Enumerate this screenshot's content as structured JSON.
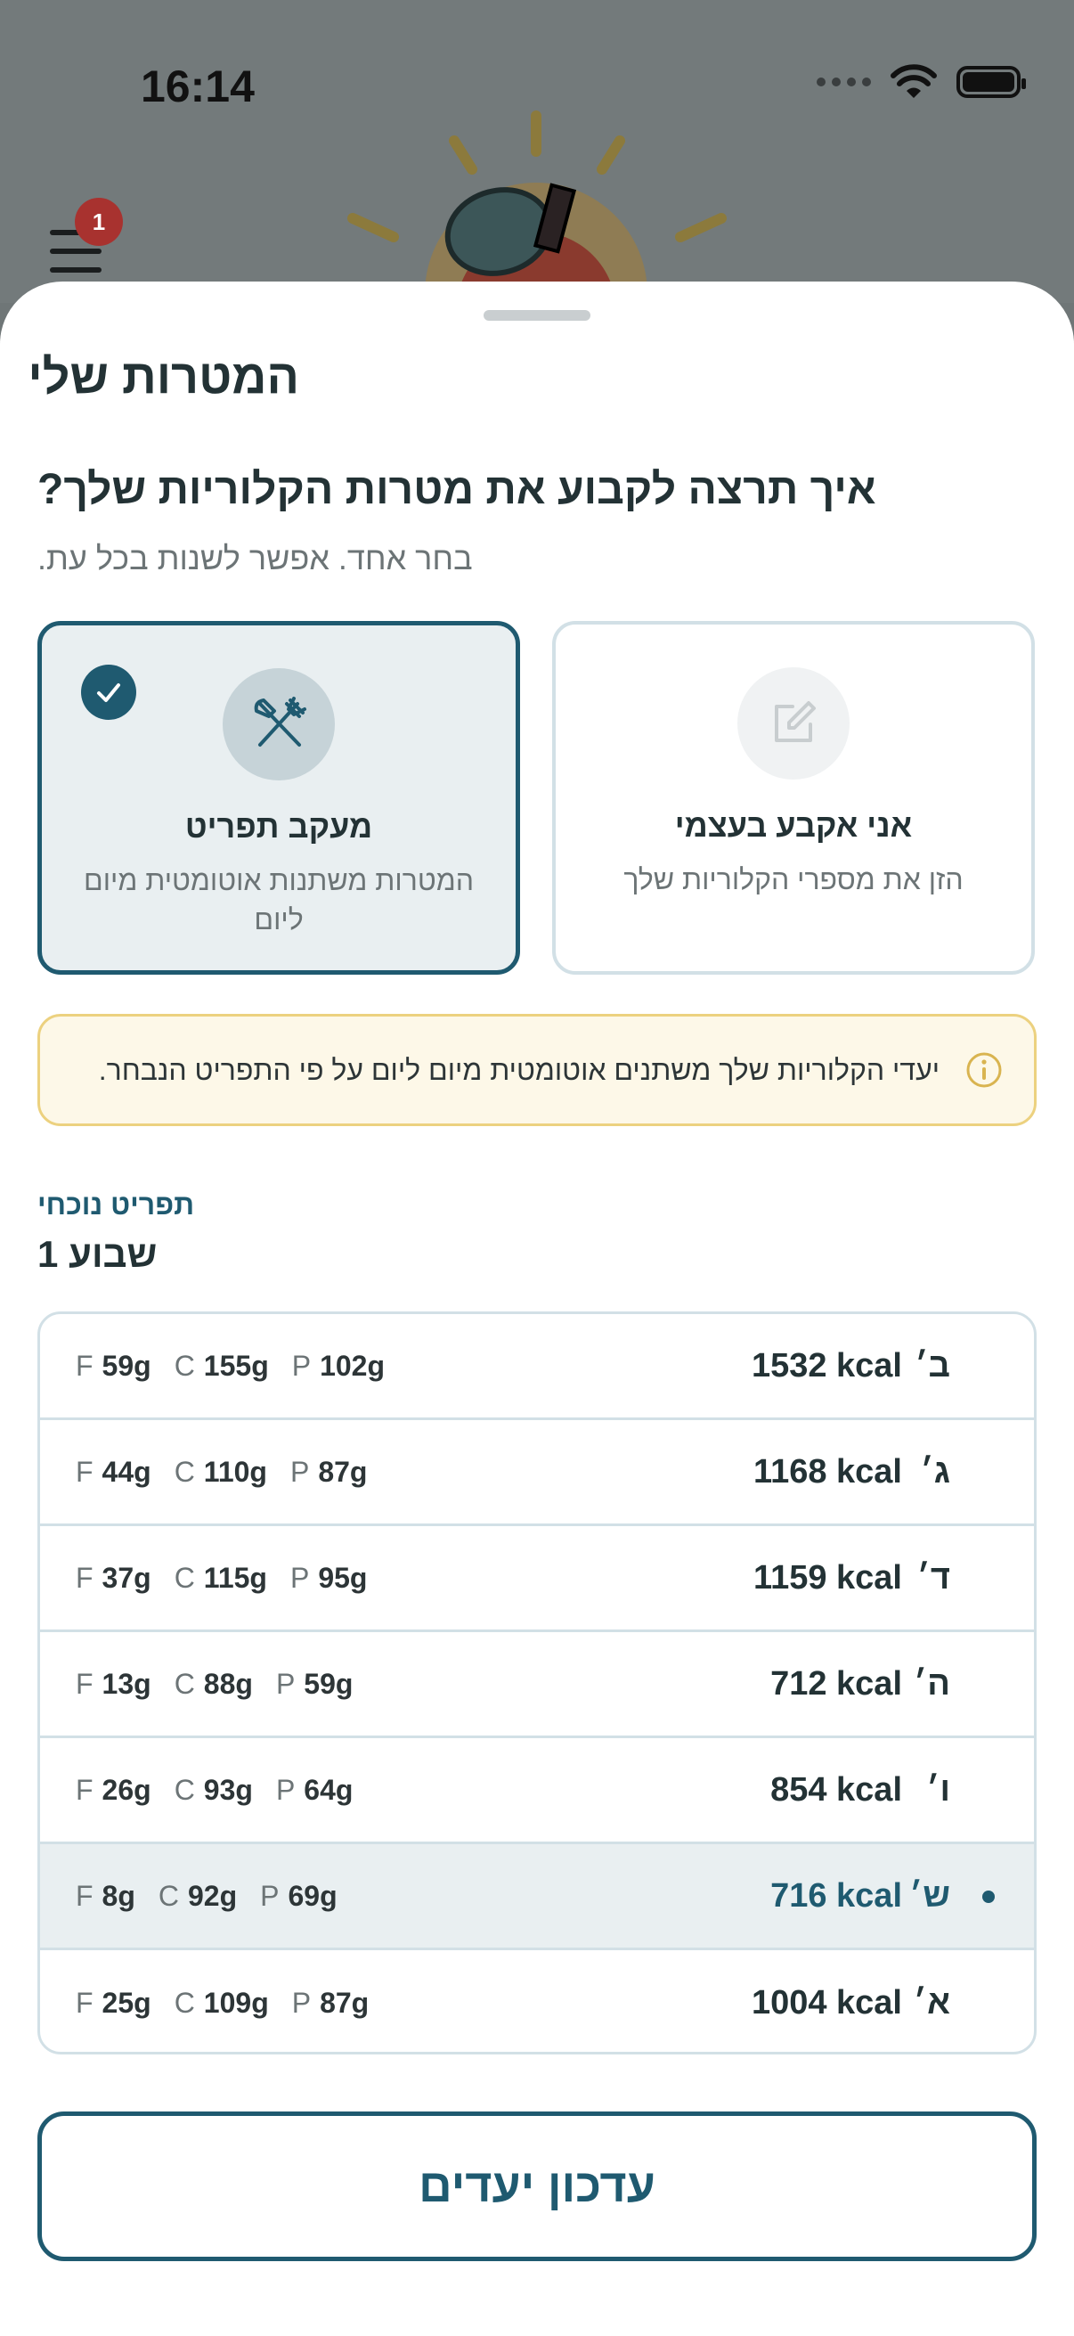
{
  "status_bar": {
    "time": "16:14"
  },
  "menu": {
    "badge_count": "1"
  },
  "sheet": {
    "title": "המטרות שלי",
    "question": "איך תרצה לקבוע את מטרות הקלוריות שלך?",
    "hint": "בחר אחד. אפשר לשנות בכל עת."
  },
  "options": {
    "tracker": {
      "title": "מעקב תפריט",
      "subtitle": "המטרות משתנות אוטומטית מיום ליום",
      "selected": true,
      "icon": "cutlery-icon"
    },
    "manual": {
      "title": "אני אקבע בעצמי",
      "subtitle": "הזן את מספרי הקלוריות שלך",
      "selected": false,
      "icon": "edit-icon"
    }
  },
  "info_banner": {
    "text": "יעדי הקלוריות שלך משתנים אוטומטית מיום ליום על פי התפריט הנבחר.",
    "icon": "info-icon"
  },
  "plan": {
    "label": "תפריט נוכחי",
    "name": "שבוע 1"
  },
  "days": [
    {
      "day": "ב׳",
      "kcal": "1532 kcal",
      "p": "102g",
      "c": "155g",
      "f": "59g"
    },
    {
      "day": "ג׳",
      "kcal": "1168 kcal",
      "p": "87g",
      "c": "110g",
      "f": "44g"
    },
    {
      "day": "ד׳",
      "kcal": "1159 kcal",
      "p": "95g",
      "c": "115g",
      "f": "37g"
    },
    {
      "day": "ה׳",
      "kcal": "712 kcal",
      "p": "59g",
      "c": "88g",
      "f": "13g"
    },
    {
      "day": "ו׳",
      "kcal": "854 kcal",
      "p": "64g",
      "c": "93g",
      "f": "26g"
    },
    {
      "day": "ש׳",
      "kcal": "716 kcal",
      "p": "69g",
      "c": "92g",
      "f": "8g",
      "current": true
    },
    {
      "day": "א׳",
      "kcal": "1004 kcal",
      "p": "87g",
      "c": "109g",
      "f": "25g"
    }
  ],
  "macro_letters": {
    "p": "P",
    "c": "C",
    "f": "F"
  },
  "update_button": {
    "label": "עדכון יעדים"
  },
  "colors": {
    "accent": "#1f5a70",
    "text": "#233235",
    "muted": "#6c7476",
    "info_bg": "#fdf8e8",
    "info_border": "#ecd17f"
  }
}
